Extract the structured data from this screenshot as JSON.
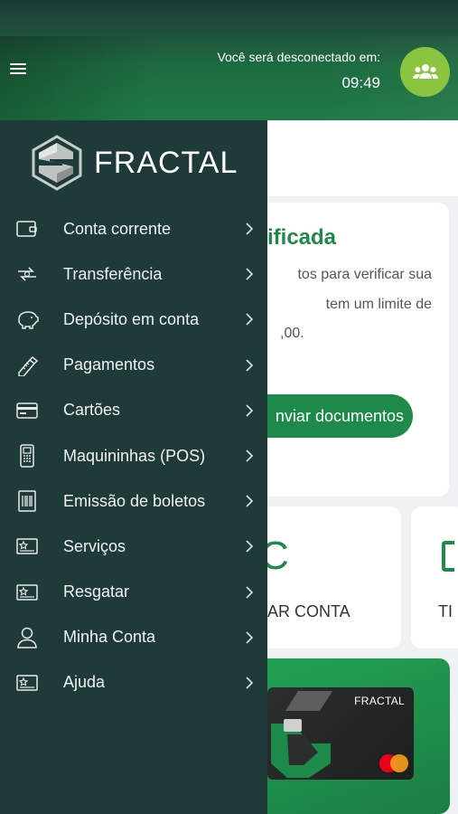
{
  "header": {
    "logout_label": "Você será desconectado em:",
    "logout_time": "09:49",
    "menu_icon": "hamburger-icon",
    "group_icon": "users-group-icon"
  },
  "drawer": {
    "logo_text": "FRACTAL",
    "items": [
      {
        "label": "Conta corrente",
        "icon": "wallet-icon"
      },
      {
        "label": "Transferência",
        "icon": "transfer-icon"
      },
      {
        "label": "Depósito em conta",
        "icon": "piggy-bank-icon"
      },
      {
        "label": "Pagamentos",
        "icon": "barcode-pen-icon"
      },
      {
        "label": "Cartões",
        "icon": "credit-card-icon"
      },
      {
        "label": "Maquininhas (POS)",
        "icon": "pos-machine-icon"
      },
      {
        "label": "Emissão de boletos",
        "icon": "boleto-document-icon"
      },
      {
        "label": "Serviços",
        "icon": "star-ticket-icon"
      },
      {
        "label": "Resgatar",
        "icon": "star-ticket-icon"
      },
      {
        "label": "Minha Conta",
        "icon": "user-icon"
      },
      {
        "label": "Ajuda",
        "icon": "star-ticket-icon"
      }
    ]
  },
  "background": {
    "verify_title_fragment": "ificada",
    "verify_desc_lines": [
      "tos para verificar sua",
      "tem um limite de",
      ",00."
    ],
    "send_button_fragment": "nviar documentos",
    "card_a_glyph": "C",
    "card_a_label_fragment": "AR CONTA",
    "card_b_label_fragment": "TI",
    "card_brand": "FRACTAL"
  },
  "colors": {
    "drawer_bg": "#1f3b39",
    "accent_green": "#1e8a4a",
    "group_button": "#8bc53f"
  }
}
